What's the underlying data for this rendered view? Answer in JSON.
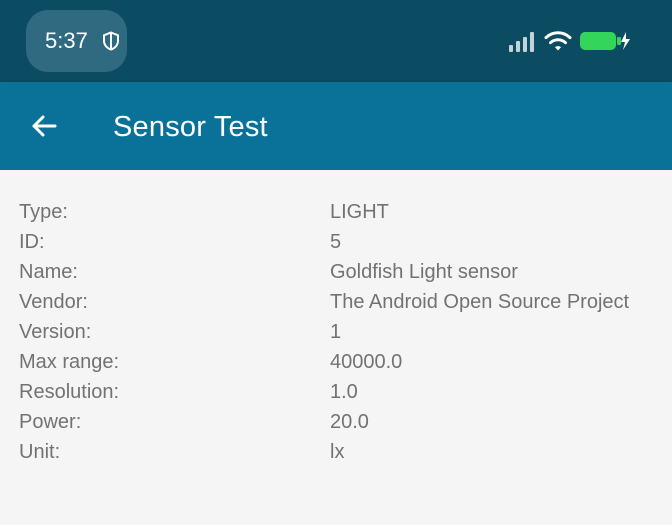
{
  "status_bar": {
    "time": "5:37",
    "icons": [
      "shield-icon",
      "signal-icon",
      "wifi-icon",
      "battery-charging-icon"
    ],
    "colors": {
      "background": "#0b4c63",
      "battery": "#33d65a"
    }
  },
  "app_bar": {
    "title": "Sensor Test",
    "back_icon": "arrow-left-icon",
    "color": "#0a7298"
  },
  "sensor_info": {
    "rows": [
      {
        "label": "Type:",
        "value": "LIGHT"
      },
      {
        "label": "ID:",
        "value": "5"
      },
      {
        "label": "Name:",
        "value": "Goldfish Light sensor"
      },
      {
        "label": "Vendor:",
        "value": "The Android Open Source Project"
      },
      {
        "label": "Version:",
        "value": "1"
      },
      {
        "label": "Max range:",
        "value": "40000.0"
      },
      {
        "label": "Resolution:",
        "value": "1.0"
      },
      {
        "label": "Power:",
        "value": "20.0"
      },
      {
        "label": "Unit:",
        "value": "lx"
      }
    ]
  }
}
